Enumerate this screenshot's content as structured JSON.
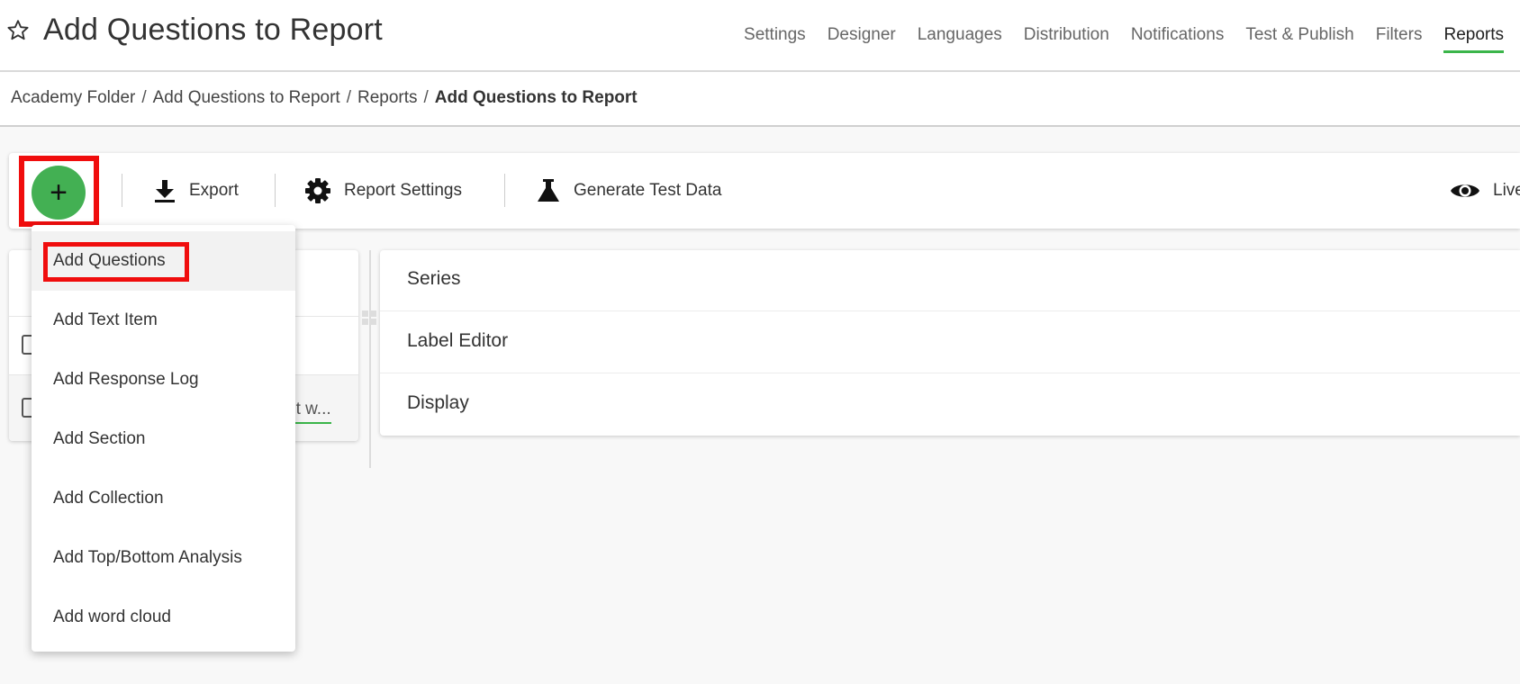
{
  "page": {
    "title": "Add Questions to Report",
    "favorite_icon": "star-icon"
  },
  "nav": [
    {
      "label": "Settings",
      "active": false
    },
    {
      "label": "Designer",
      "active": false
    },
    {
      "label": "Languages",
      "active": false
    },
    {
      "label": "Distribution",
      "active": false
    },
    {
      "label": "Notifications",
      "active": false
    },
    {
      "label": "Test & Publish",
      "active": false
    },
    {
      "label": "Filters",
      "active": false
    },
    {
      "label": "Reports",
      "active": true
    }
  ],
  "breadcrumb": {
    "items": [
      "Academy Folder",
      "Add Questions to Report",
      "Reports"
    ],
    "current": "Add Questions to Report",
    "separator": "/"
  },
  "toolbar": {
    "add_symbol": "+",
    "export_label": "Export",
    "report_settings_label": "Report Settings",
    "generate_test_data_label": "Generate Test Data",
    "live_label": "Live"
  },
  "add_menu": {
    "items": [
      "Add Questions",
      "Add Text Item",
      "Add Response Log",
      "Add Section",
      "Add Collection",
      "Add Top/Bottom Analysis",
      "Add word cloud"
    ]
  },
  "left_panel": {
    "row_text_truncated": "ut w..."
  },
  "right_panel": {
    "sections": [
      "Series",
      "Label Editor",
      "Display"
    ]
  },
  "colors": {
    "accent_green": "#3bb54a",
    "add_button_green": "#43b053",
    "highlight_red": "#f00d0d"
  }
}
